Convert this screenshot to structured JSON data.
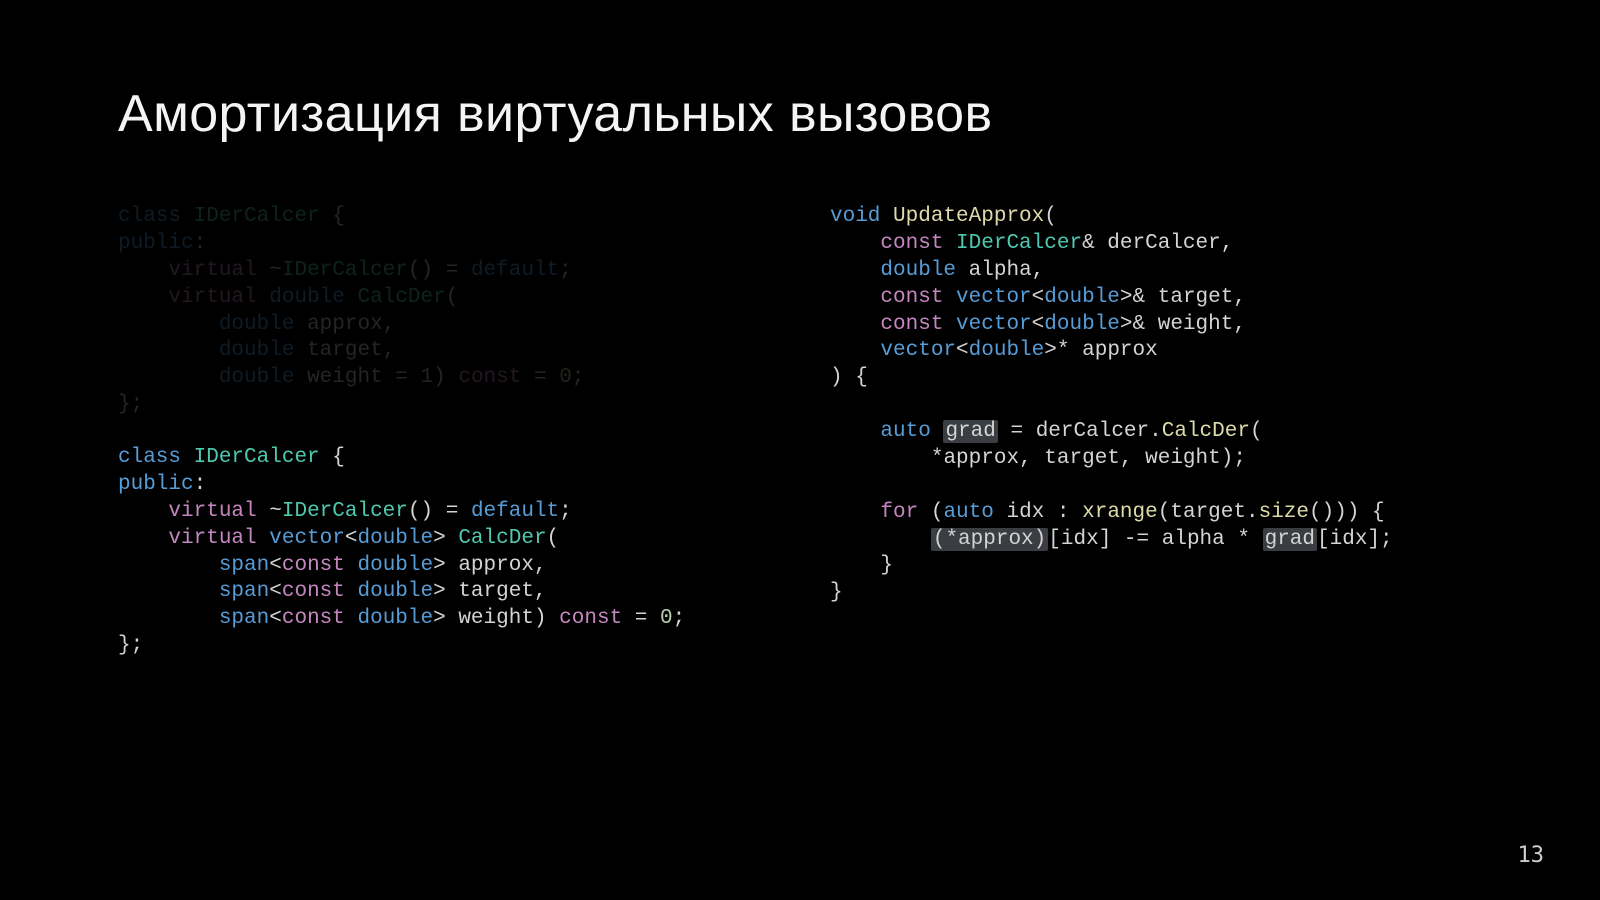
{
  "slide": {
    "title": "Амортизация виртуальных вызовов",
    "page_number": "13",
    "left_block_dim_tokens": [
      [
        "kw2",
        "class"
      ],
      [
        "sp",
        " "
      ],
      [
        "ty",
        "IDerCalcer"
      ],
      [
        "sp",
        " "
      ],
      [
        "pn",
        "{"
      ],
      [
        "nl"
      ],
      [
        "kw2",
        "public"
      ],
      [
        "pn",
        ":"
      ],
      [
        "nl"
      ],
      [
        "sp",
        "    "
      ],
      [
        "kw",
        "virtual"
      ],
      [
        "sp",
        " "
      ],
      [
        "pn",
        "~"
      ],
      [
        "ty",
        "IDerCalcer"
      ],
      [
        "pn",
        "()"
      ],
      [
        "sp",
        " "
      ],
      [
        "op",
        "="
      ],
      [
        "sp",
        " "
      ],
      [
        "lit",
        "default"
      ],
      [
        "pn",
        ";"
      ],
      [
        "nl"
      ],
      [
        "sp",
        "    "
      ],
      [
        "kw",
        "virtual"
      ],
      [
        "sp",
        " "
      ],
      [
        "kw2",
        "double"
      ],
      [
        "sp",
        " "
      ],
      [
        "ty",
        "CalcDer"
      ],
      [
        "pn",
        "("
      ],
      [
        "nl"
      ],
      [
        "sp",
        "        "
      ],
      [
        "kw2",
        "double"
      ],
      [
        "sp",
        " "
      ],
      [
        "id",
        "approx"
      ],
      [
        "pn",
        ","
      ],
      [
        "nl"
      ],
      [
        "sp",
        "        "
      ],
      [
        "kw2",
        "double"
      ],
      [
        "sp",
        " "
      ],
      [
        "id",
        "target"
      ],
      [
        "pn",
        ","
      ],
      [
        "nl"
      ],
      [
        "sp",
        "        "
      ],
      [
        "kw2",
        "double"
      ],
      [
        "sp",
        " "
      ],
      [
        "id",
        "weight"
      ],
      [
        "sp",
        " "
      ],
      [
        "op",
        "="
      ],
      [
        "sp",
        " "
      ],
      [
        "nm",
        "1"
      ],
      [
        "pn",
        ")"
      ],
      [
        "sp",
        " "
      ],
      [
        "kw",
        "const"
      ],
      [
        "sp",
        " "
      ],
      [
        "op",
        "="
      ],
      [
        "sp",
        " "
      ],
      [
        "nm",
        "0"
      ],
      [
        "pn",
        ";"
      ],
      [
        "nl"
      ],
      [
        "pn",
        "};"
      ]
    ],
    "left_block_tokens": [
      [
        "kw2",
        "class"
      ],
      [
        "sp",
        " "
      ],
      [
        "ty",
        "IDerCalcer"
      ],
      [
        "sp",
        " "
      ],
      [
        "pn",
        "{"
      ],
      [
        "nl"
      ],
      [
        "kw2",
        "public"
      ],
      [
        "pn",
        ":"
      ],
      [
        "nl"
      ],
      [
        "sp",
        "    "
      ],
      [
        "kw",
        "virtual"
      ],
      [
        "sp",
        " "
      ],
      [
        "pn",
        "~"
      ],
      [
        "ty",
        "IDerCalcer"
      ],
      [
        "pn",
        "()"
      ],
      [
        "sp",
        " "
      ],
      [
        "op",
        "="
      ],
      [
        "sp",
        " "
      ],
      [
        "lit",
        "default"
      ],
      [
        "pn",
        ";"
      ],
      [
        "nl"
      ],
      [
        "sp",
        "    "
      ],
      [
        "kw",
        "virtual"
      ],
      [
        "sp",
        " "
      ],
      [
        "kw2",
        "vector"
      ],
      [
        "pn",
        "<"
      ],
      [
        "kw2",
        "double"
      ],
      [
        "pn",
        ">"
      ],
      [
        "sp",
        " "
      ],
      [
        "ty",
        "CalcDer"
      ],
      [
        "pn",
        "("
      ],
      [
        "nl"
      ],
      [
        "sp",
        "        "
      ],
      [
        "kw2",
        "span"
      ],
      [
        "pn",
        "<"
      ],
      [
        "kw",
        "const"
      ],
      [
        "sp",
        " "
      ],
      [
        "kw2",
        "double"
      ],
      [
        "pn",
        ">"
      ],
      [
        "sp",
        " "
      ],
      [
        "id",
        "approx"
      ],
      [
        "pn",
        ","
      ],
      [
        "nl"
      ],
      [
        "sp",
        "        "
      ],
      [
        "kw2",
        "span"
      ],
      [
        "pn",
        "<"
      ],
      [
        "kw",
        "const"
      ],
      [
        "sp",
        " "
      ],
      [
        "kw2",
        "double"
      ],
      [
        "pn",
        ">"
      ],
      [
        "sp",
        " "
      ],
      [
        "id",
        "target"
      ],
      [
        "pn",
        ","
      ],
      [
        "nl"
      ],
      [
        "sp",
        "        "
      ],
      [
        "kw2",
        "span"
      ],
      [
        "pn",
        "<"
      ],
      [
        "kw",
        "const"
      ],
      [
        "sp",
        " "
      ],
      [
        "kw2",
        "double"
      ],
      [
        "pn",
        ">"
      ],
      [
        "sp",
        " "
      ],
      [
        "id",
        "weight"
      ],
      [
        "pn",
        ")"
      ],
      [
        "sp",
        " "
      ],
      [
        "kw",
        "const"
      ],
      [
        "sp",
        " "
      ],
      [
        "op",
        "="
      ],
      [
        "sp",
        " "
      ],
      [
        "nm",
        "0"
      ],
      [
        "pn",
        ";"
      ],
      [
        "nl"
      ],
      [
        "pn",
        "};"
      ]
    ],
    "right_block_tokens": [
      [
        "kw2",
        "void"
      ],
      [
        "sp",
        " "
      ],
      [
        "fn",
        "UpdateApprox"
      ],
      [
        "pn",
        "("
      ],
      [
        "nl"
      ],
      [
        "sp",
        "    "
      ],
      [
        "kw",
        "const"
      ],
      [
        "sp",
        " "
      ],
      [
        "ty",
        "IDerCalcer"
      ],
      [
        "pn",
        "&"
      ],
      [
        "sp",
        " "
      ],
      [
        "id",
        "derCalcer"
      ],
      [
        "pn",
        ","
      ],
      [
        "nl"
      ],
      [
        "sp",
        "    "
      ],
      [
        "kw2",
        "double"
      ],
      [
        "sp",
        " "
      ],
      [
        "id",
        "alpha"
      ],
      [
        "pn",
        ","
      ],
      [
        "nl"
      ],
      [
        "sp",
        "    "
      ],
      [
        "kw",
        "const"
      ],
      [
        "sp",
        " "
      ],
      [
        "kw2",
        "vector"
      ],
      [
        "pn",
        "<"
      ],
      [
        "kw2",
        "double"
      ],
      [
        "pn",
        ">"
      ],
      [
        "pn",
        "&"
      ],
      [
        "sp",
        " "
      ],
      [
        "id",
        "target"
      ],
      [
        "pn",
        ","
      ],
      [
        "nl"
      ],
      [
        "sp",
        "    "
      ],
      [
        "kw",
        "const"
      ],
      [
        "sp",
        " "
      ],
      [
        "kw2",
        "vector"
      ],
      [
        "pn",
        "<"
      ],
      [
        "kw2",
        "double"
      ],
      [
        "pn",
        ">"
      ],
      [
        "pn",
        "&"
      ],
      [
        "sp",
        " "
      ],
      [
        "id",
        "weight"
      ],
      [
        "pn",
        ","
      ],
      [
        "nl"
      ],
      [
        "sp",
        "    "
      ],
      [
        "kw2",
        "vector"
      ],
      [
        "pn",
        "<"
      ],
      [
        "kw2",
        "double"
      ],
      [
        "pn",
        ">"
      ],
      [
        "pn",
        "*"
      ],
      [
        "sp",
        " "
      ],
      [
        "id",
        "approx"
      ],
      [
        "nl"
      ],
      [
        "pn",
        ")"
      ],
      [
        "sp",
        " "
      ],
      [
        "pn",
        "{"
      ],
      [
        "nl"
      ],
      [
        "nl"
      ],
      [
        "sp",
        "    "
      ],
      [
        "kw2",
        "auto"
      ],
      [
        "sp",
        " "
      ],
      [
        "hl-open"
      ],
      [
        "id",
        "grad"
      ],
      [
        "hl-close"
      ],
      [
        "sp",
        " "
      ],
      [
        "op",
        "="
      ],
      [
        "sp",
        " "
      ],
      [
        "id",
        "derCalcer"
      ],
      [
        "pn",
        "."
      ],
      [
        "fn",
        "CalcDer"
      ],
      [
        "pn",
        "("
      ],
      [
        "nl"
      ],
      [
        "sp",
        "        "
      ],
      [
        "pn",
        "*"
      ],
      [
        "id",
        "approx"
      ],
      [
        "pn",
        ","
      ],
      [
        "sp",
        " "
      ],
      [
        "id",
        "target"
      ],
      [
        "pn",
        ","
      ],
      [
        "sp",
        " "
      ],
      [
        "id",
        "weight"
      ],
      [
        "pn",
        ");"
      ],
      [
        "nl"
      ],
      [
        "nl"
      ],
      [
        "sp",
        "    "
      ],
      [
        "kw",
        "for"
      ],
      [
        "sp",
        " "
      ],
      [
        "pn",
        "("
      ],
      [
        "kw2",
        "auto"
      ],
      [
        "sp",
        " "
      ],
      [
        "id",
        "idx"
      ],
      [
        "sp",
        " "
      ],
      [
        "pn",
        ":"
      ],
      [
        "sp",
        " "
      ],
      [
        "fn",
        "xrange"
      ],
      [
        "pn",
        "("
      ],
      [
        "id",
        "target"
      ],
      [
        "pn",
        "."
      ],
      [
        "fn",
        "size"
      ],
      [
        "pn",
        "()))"
      ],
      [
        "sp",
        " "
      ],
      [
        "pn",
        "{"
      ],
      [
        "nl"
      ],
      [
        "sp",
        "        "
      ],
      [
        "hl-open"
      ],
      [
        "pn",
        "("
      ],
      [
        "pn",
        "*"
      ],
      [
        "id",
        "approx"
      ],
      [
        "pn",
        ")"
      ],
      [
        "hl-close"
      ],
      [
        "pn",
        "["
      ],
      [
        "id",
        "idx"
      ],
      [
        "pn",
        "]"
      ],
      [
        "sp",
        " "
      ],
      [
        "op",
        "-="
      ],
      [
        "sp",
        " "
      ],
      [
        "id",
        "alpha"
      ],
      [
        "sp",
        " "
      ],
      [
        "op",
        "*"
      ],
      [
        "sp",
        " "
      ],
      [
        "hl-open"
      ],
      [
        "id",
        "grad"
      ],
      [
        "hl-close"
      ],
      [
        "pn",
        "["
      ],
      [
        "id",
        "idx"
      ],
      [
        "pn",
        "];"
      ],
      [
        "nl"
      ],
      [
        "sp",
        "    "
      ],
      [
        "pn",
        "}"
      ],
      [
        "nl"
      ],
      [
        "pn",
        "}"
      ]
    ]
  }
}
